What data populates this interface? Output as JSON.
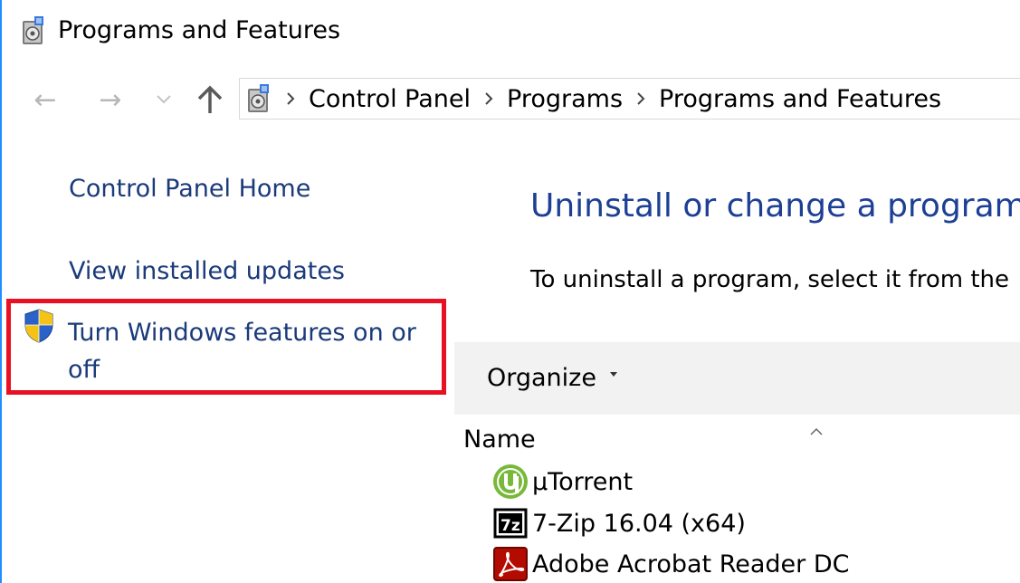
{
  "window": {
    "title": "Programs and Features"
  },
  "nav": {
    "back_icon": "←",
    "forward_icon": "→",
    "recent_icon": "⌄",
    "up_icon": "↑"
  },
  "breadcrumb": [
    "Control Panel",
    "Programs",
    "Programs and Features"
  ],
  "sidebar": {
    "home_link": "Control Panel Home",
    "updates_link": "View installed updates",
    "features_link": "Turn Windows features on or off"
  },
  "main": {
    "heading": "Uninstall or change a program",
    "description": "To uninstall a program, select it from the"
  },
  "toolbar": {
    "organize_label": "Organize"
  },
  "list": {
    "column_name": "Name",
    "programs": [
      "µTorrent",
      "7-Zip 16.04 (x64)",
      "Adobe Acrobat Reader DC"
    ]
  },
  "colors": {
    "link": "#1a3a7a",
    "heading": "#1d3f94",
    "highlight_border": "#e81123",
    "toolbar_bg": "#f2f2f2",
    "window_edge": "#1e90ff"
  },
  "icons": {
    "title": "control-panel-icon",
    "address": "control-panel-icon",
    "shield": "uac-shield-icon",
    "programs": [
      "utorrent-icon",
      "7zip-icon",
      "acrobat-reader-icon"
    ]
  }
}
